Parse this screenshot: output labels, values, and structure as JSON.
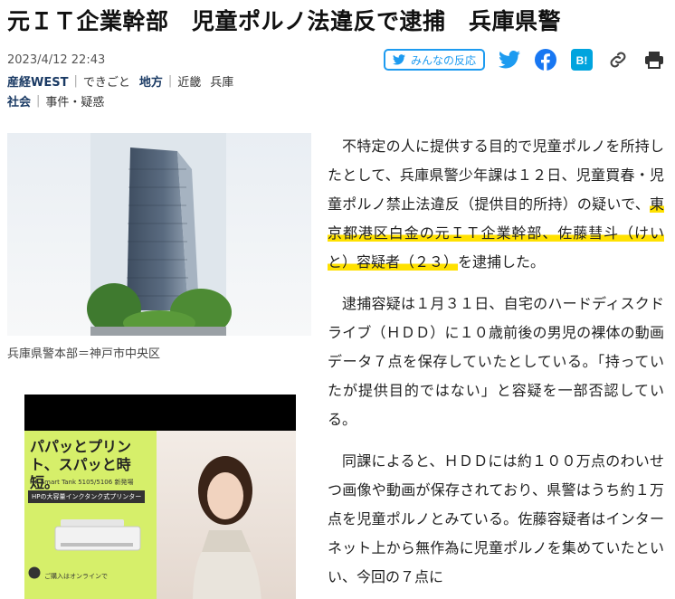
{
  "headline": "元ＩＴ企業幹部　児童ポルノ法違反で逮捕　兵庫県警",
  "date": "2023/4/12 22:43",
  "share": {
    "reactions_label": "みんなの反応",
    "icons": [
      "twitter-icon",
      "facebook-icon",
      "hatena-bookmark-icon",
      "link-icon",
      "print-icon"
    ],
    "hatena_label": "B!"
  },
  "categories": {
    "row1": {
      "main": "産経WEST",
      "items": [
        "できごと",
        "地方",
        "近畿",
        "兵庫"
      ]
    },
    "row2": {
      "main": "社会",
      "items": [
        "事件・疑惑"
      ]
    }
  },
  "photo_caption": "兵庫県警本部＝神戸市中央区",
  "ad": {
    "title": "パパッとプリント、スパッと時短。",
    "sub1": "HP Smart Tank 5105/5106 新発場",
    "sub2": "HPの大容量インクタンク式プリンター",
    "footer": "ご購入はオンラインで",
    "logo": "hp"
  },
  "article": {
    "p1_pre": "不特定の人に提供する目的で児童ポルノを所持したとして、兵庫県警少年課は１２日、児童買春・児童ポルノ禁止法違反（提供目的所持）の疑いで、",
    "p1_highlight": "東京都港区白金の元ＩＴ企業幹部、佐藤彗斗（けいと）容疑者（２３）",
    "p1_post": "を逮捕した。",
    "p2": "逮捕容疑は１月３１日、自宅のハードディスクドライブ（ＨＤＤ）に１０歳前後の男児の裸体の動画データ７点を保存していたとしている。「持っていたが提供目的ではない」と容疑を一部否認している。",
    "p3": "同課によると、ＨＤＤには約１００万点のわいせつ画像や動画が保存されており、県警はうち約１万点を児童ポルノとみている。佐藤容疑者はインターネット上から無作為に児童ポルノを集めていたといい、今回の７点に"
  },
  "colors": {
    "accent": "#1d9bf0",
    "highlight": "#ffe100",
    "category": "#1a3a64"
  }
}
